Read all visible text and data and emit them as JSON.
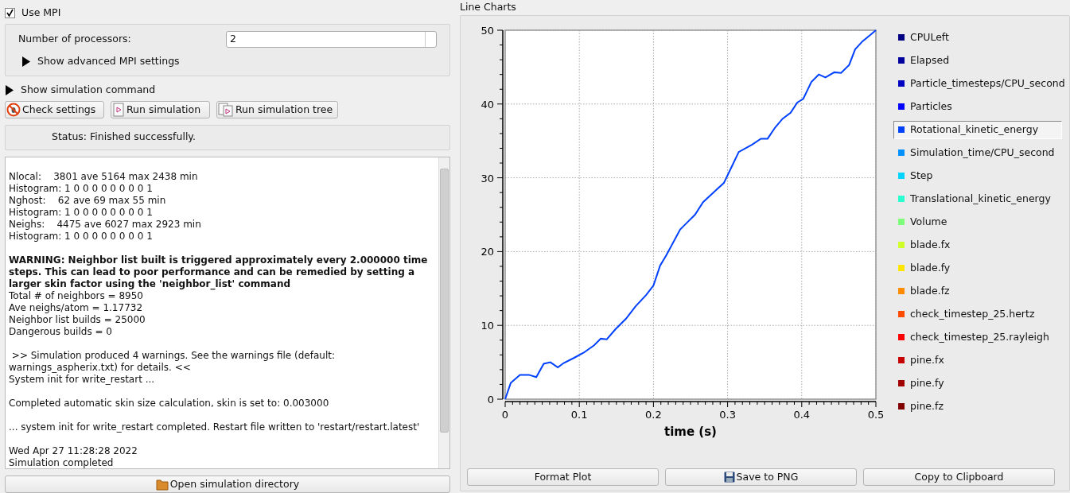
{
  "mpi": {
    "label": "Use MPI",
    "checked": true,
    "processors_label": "Number of processors:",
    "processors_value": "2",
    "advanced": {
      "label": "Show advanced MPI settings",
      "expanded": false
    }
  },
  "simulation_command": {
    "label": "Show simulation command",
    "expanded": false
  },
  "actions": [
    {
      "kind": "check",
      "label": "Check settings"
    },
    {
      "kind": "run",
      "label": "Run simulation"
    },
    {
      "kind": "tree",
      "label": "Run simulation tree"
    }
  ],
  "status": "Status: Finished successfully.",
  "log": [
    {
      "text": "Nlocal:    3801 ave 5164 max 2438 min",
      "bold": false,
      "space_before": true
    },
    {
      "text": "Histogram: 1 0 0 0 0 0 0 0 0 1",
      "bold": false,
      "space_before": false
    },
    {
      "text": "Nghost:    62 ave 69 max 55 min",
      "bold": false,
      "space_before": false
    },
    {
      "text": "Histogram: 1 0 0 0 0 0 0 0 0 1",
      "bold": false,
      "space_before": false
    },
    {
      "text": "Neighs:    4475 ave 6027 max 2923 min",
      "bold": false,
      "space_before": false
    },
    {
      "text": "Histogram: 1 0 0 0 0 0 0 0 0 1",
      "bold": false,
      "space_before": false
    },
    {
      "text": "WARNING: Neighbor list built is triggered approximately every 2.000000 time steps. This can lead to poor performance and can be remedied by setting a larger skin factor using the 'neighbor_list' command",
      "bold": true,
      "space_before": true
    },
    {
      "text": "Total # of neighbors = 8950",
      "bold": false,
      "space_before": false
    },
    {
      "text": "Ave neighs/atom = 1.17732",
      "bold": false,
      "space_before": false
    },
    {
      "text": "Neighbor list builds = 25000",
      "bold": false,
      "space_before": false
    },
    {
      "text": "Dangerous builds = 0",
      "bold": false,
      "space_before": false
    },
    {
      "text": " >> Simulation produced 4 warnings. See the warnings file (default: warnings_aspherix.txt) for details. <<",
      "bold": false,
      "space_before": true
    },
    {
      "text": "System init for write_restart ...",
      "bold": false,
      "space_before": false
    },
    {
      "text": "Completed automatic skin size calculation, skin is set to: 0.003000",
      "bold": false,
      "space_before": true
    },
    {
      "text": "... system init for write_restart completed. Restart file written to 'restart/restart.latest'",
      "bold": false,
      "space_before": true
    },
    {
      "text": "Wed Apr 27 11:28:28 2022",
      "bold": false,
      "space_before": true
    },
    {
      "text": "Simulation completed",
      "bold": false,
      "space_before": false
    }
  ],
  "open_directory_button": "Open simulation directory",
  "line_charts": {
    "title": "Line Charts",
    "chart_data": {
      "type": "line",
      "grid": true,
      "xlabel": "time (s)",
      "xlim": [
        0,
        0.5
      ],
      "ylim": [
        0,
        50
      ],
      "xticks": [
        0,
        0.1,
        0.2,
        0.3,
        0.4,
        0.5
      ],
      "yticks": [
        0,
        10,
        20,
        30,
        40,
        50
      ],
      "x": [
        0,
        0.0075,
        0.02,
        0.032,
        0.042,
        0.052,
        0.061,
        0.071,
        0.079,
        0.093,
        0.106,
        0.12,
        0.129,
        0.137,
        0.149,
        0.163,
        0.176,
        0.19,
        0.2,
        0.209,
        0.2167,
        0.236,
        0.247,
        0.256,
        0.267,
        0.283,
        0.295,
        0.306,
        0.315,
        0.333,
        0.345,
        0.354,
        0.364,
        0.374,
        0.385,
        0.394,
        0.402,
        0.413,
        0.423,
        0.432,
        0.444,
        0.453,
        0.464,
        0.472,
        0.482,
        0.493,
        0.5
      ],
      "series": [
        {
          "color": "#0040ff",
          "values": [
            0,
            2.2,
            3.3,
            3.3,
            3.0,
            4.8,
            5.0,
            4.3,
            4.9,
            5.6,
            6.3,
            7.3,
            8.2,
            8.1,
            9.5,
            10.9,
            12.6,
            14.1,
            15.4,
            18.1,
            19.4,
            23.0,
            24.1,
            25.0,
            26.7,
            28.2,
            29.3,
            31.6,
            33.5,
            34.5,
            35.3,
            35.3,
            36.8,
            38.0,
            38.8,
            40.2,
            40.7,
            43.0,
            44.0,
            43.6,
            44.3,
            44.2,
            45.3,
            47.4,
            48.5,
            49.4,
            50
          ]
        }
      ]
    },
    "legend": [
      {
        "label": "CPULeft",
        "color": "#000080",
        "selected": false
      },
      {
        "label": "Elapsed",
        "color": "#00009f",
        "selected": false
      },
      {
        "label": "Particle_timesteps/CPU_second",
        "color": "#0000c0",
        "selected": false
      },
      {
        "label": "Particles",
        "color": "#0000ff",
        "selected": false
      },
      {
        "label": "Rotational_kinetic_energy",
        "color": "#0040ff",
        "selected": true
      },
      {
        "label": "Simulation_time/CPU_second",
        "color": "#0090ff",
        "selected": false
      },
      {
        "label": "Step",
        "color": "#00d4ff",
        "selected": false
      },
      {
        "label": "Translational_kinetic_energy",
        "color": "#29ffce",
        "selected": false
      },
      {
        "label": "Volume",
        "color": "#7dff7a",
        "selected": false
      },
      {
        "label": "blade.fx",
        "color": "#ceff29",
        "selected": false
      },
      {
        "label": "blade.fy",
        "color": "#ffe600",
        "selected": false
      },
      {
        "label": "blade.fz",
        "color": "#ff8c00",
        "selected": false
      },
      {
        "label": "check_timestep_25.hertz",
        "color": "#ff4a00",
        "selected": false
      },
      {
        "label": "check_timestep_25.rayleigh",
        "color": "#ff0000",
        "selected": false
      },
      {
        "label": "pine.fx",
        "color": "#c80000",
        "selected": false
      },
      {
        "label": "pine.fy",
        "color": "#a00000",
        "selected": false
      },
      {
        "label": "pine.fz",
        "color": "#800000",
        "selected": false
      }
    ],
    "buttons": [
      {
        "kind": "format",
        "label": "Format Plot"
      },
      {
        "kind": "save",
        "label": "Save to PNG"
      },
      {
        "kind": "copy",
        "label": "Copy to Clipboard"
      }
    ]
  }
}
